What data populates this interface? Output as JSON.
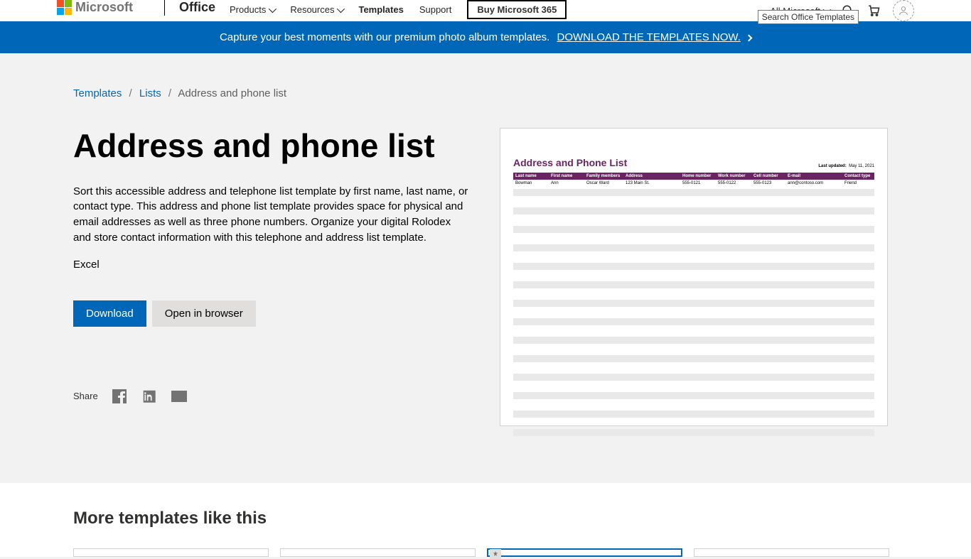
{
  "header": {
    "brand": "Microsoft",
    "office": "Office",
    "nav": {
      "products": "Products",
      "resources": "Resources",
      "templates": "Templates",
      "support": "Support",
      "buy": "Buy Microsoft 365"
    },
    "all_microsoft": "All Microsoft",
    "search_tooltip": "Search Office Templates"
  },
  "promo": {
    "text": "Capture your best moments with our premium photo album templates.",
    "link": "DOWNLOAD THE TEMPLATES NOW."
  },
  "breadcrumbs": {
    "root": "Templates",
    "cat": "Lists",
    "current": "Address and phone list"
  },
  "page": {
    "title": "Address and phone list",
    "description": "Sort this accessible address and telephone list template by first name, last name, or contact type. This address and phone list template provides space for physical and email addresses as well as three phone numbers. Organize your digital Rolodex and store contact information with this telephone and address list template.",
    "app": "Excel",
    "download": "Download",
    "open": "Open in browser"
  },
  "share": {
    "label": "Share"
  },
  "preview": {
    "title": "Address and Phone List",
    "last_updated_label": "Last updated:",
    "last_updated_value": "May 11, 2021",
    "cols": [
      "Last name",
      "First name",
      "Family members",
      "Address",
      "Home number",
      "Work number",
      "Cell number",
      "E-mail",
      "Contact type"
    ],
    "row": [
      "Bowman",
      "Ann",
      "Oscar Ward",
      "123 Main St.",
      "555-0121",
      "555-0122",
      "555-0123",
      "ann@contoso.com",
      "Friend"
    ]
  },
  "more": {
    "title": "More templates like this"
  }
}
